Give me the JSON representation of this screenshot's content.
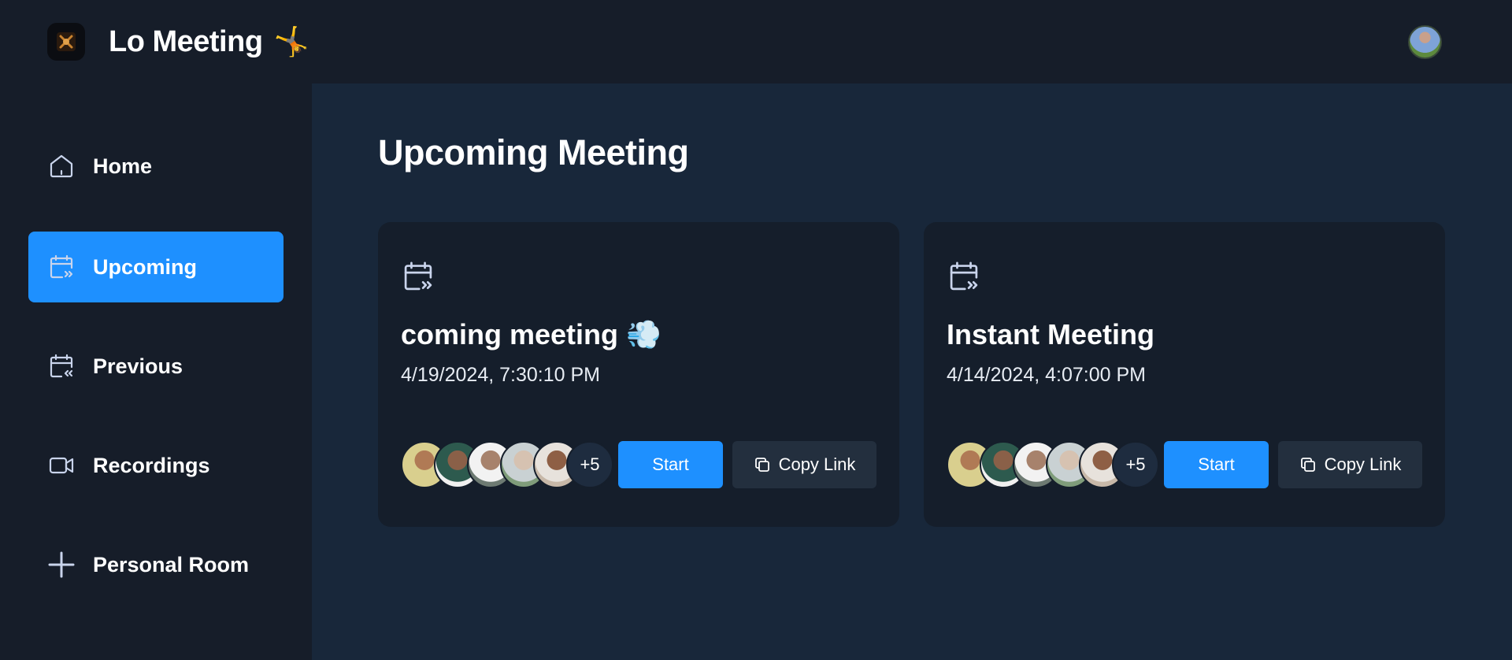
{
  "app": {
    "title": "Lo Meeting",
    "title_emoji": "🤸",
    "logo_icon": "logo-icon"
  },
  "colors": {
    "accent": "#1e90ff",
    "sidebar_bg": "#161d29",
    "main_bg": "#18273a",
    "card_bg": "#151e2b"
  },
  "sidebar": {
    "items": [
      {
        "label": "Home",
        "icon": "home-icon",
        "active": false
      },
      {
        "label": "Upcoming",
        "icon": "calendar-upcoming-icon",
        "active": true
      },
      {
        "label": "Previous",
        "icon": "calendar-previous-icon",
        "active": false
      },
      {
        "label": "Recordings",
        "icon": "video-icon",
        "active": false
      },
      {
        "label": "Personal Room",
        "icon": "plus-icon",
        "active": false
      }
    ]
  },
  "main": {
    "page_title": "Upcoming Meeting",
    "meetings": [
      {
        "title": "coming meeting 💨",
        "date": "4/19/2024, 7:30:10 PM",
        "more_attendees": "+5",
        "start_label": "Start",
        "copy_label": "Copy Link"
      },
      {
        "title": "Instant Meeting",
        "date": "4/14/2024, 4:07:00 PM",
        "more_attendees": "+5",
        "start_label": "Start",
        "copy_label": "Copy Link"
      }
    ]
  }
}
